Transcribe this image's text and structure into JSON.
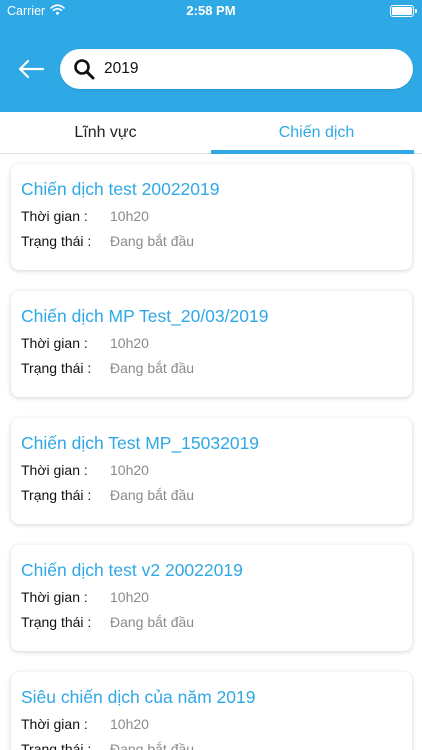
{
  "status_bar": {
    "carrier": "Carrier",
    "time": "2:58 PM"
  },
  "header": {
    "back_icon": "arrow-left-icon",
    "search_icon": "search-icon",
    "search_value": "2019",
    "accent_color": "#2fa8e6"
  },
  "tabs": [
    {
      "label": "Lĩnh vực",
      "active": false
    },
    {
      "label": "Chiến dịch",
      "active": true
    }
  ],
  "results": [
    {
      "title": "Chiến dịch test 20022019",
      "time_label": "Thời gian :",
      "time_value": "10h20",
      "status_label": "Trạng thái :",
      "status_value": "Đang bắt đầu"
    },
    {
      "title": "Chiến dịch MP Test_20/03/2019",
      "time_label": "Thời gian :",
      "time_value": "10h20",
      "status_label": "Trạng thái :",
      "status_value": "Đang bắt đầu"
    },
    {
      "title": "Chiến dịch Test MP_15032019",
      "time_label": "Thời gian :",
      "time_value": "10h20",
      "status_label": "Trạng thái :",
      "status_value": "Đang bắt đầu"
    },
    {
      "title": "Chiến dịch test v2 20022019",
      "time_label": "Thời gian :",
      "time_value": "10h20",
      "status_label": "Trạng thái :",
      "status_value": "Đang bắt đầu"
    },
    {
      "title": "Siêu chiến dịch của năm 2019",
      "time_label": "Thời gian :",
      "time_value": "10h20",
      "status_label": "Trạng thái :",
      "status_value": "Đang bắt đầu"
    }
  ]
}
